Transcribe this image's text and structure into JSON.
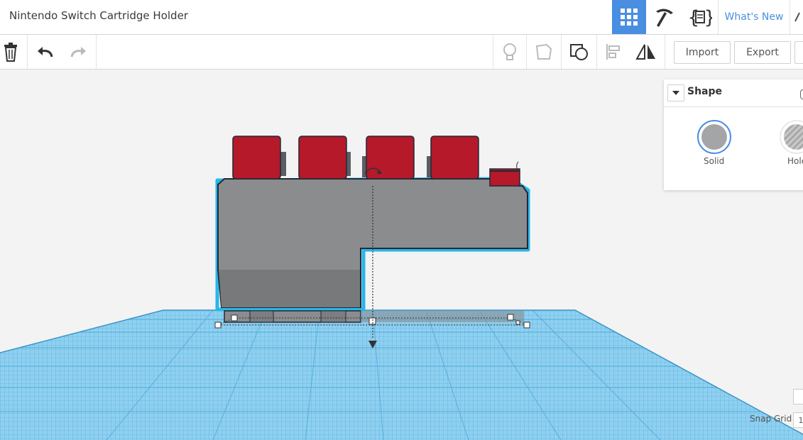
{
  "header": {
    "title": "Nintendo Switch Cartridge Holder",
    "whats_new": "What's New",
    "icons": [
      "grid-view-icon",
      "pickaxe-icon",
      "code-blocks-icon"
    ]
  },
  "toolbar": {
    "import_label": "Import",
    "export_label": "Export",
    "icons": [
      "trash-icon",
      "undo-icon",
      "redo-icon",
      "lightbulb-icon",
      "group-icon",
      "ungroup-icon",
      "align-icon",
      "mirror-icon"
    ]
  },
  "shape_panel": {
    "title": "Shape",
    "solid_label": "Solid",
    "hole_label": "Hole"
  },
  "snap_grid": {
    "label": "Snap Grid",
    "value": "1"
  },
  "colors": {
    "accent": "#4a8ee2",
    "cartridge_red": "#b5192a",
    "body_gray": "#8a8c8e",
    "grid_blue": "#5bb6e6",
    "selection_outline": "#29b6e8"
  }
}
